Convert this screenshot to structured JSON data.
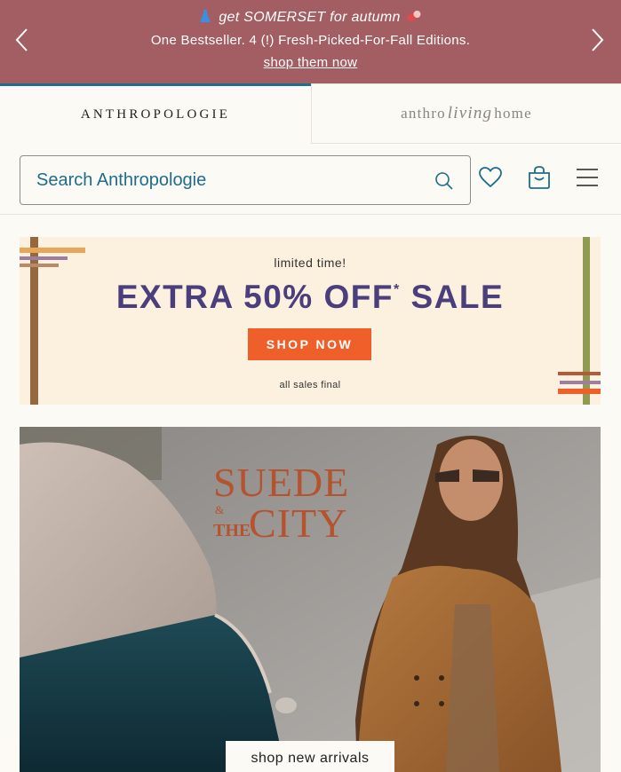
{
  "promo": {
    "line1": "get SOMERSET for autumn",
    "line2": "One Bestseller. 4 (!) Fresh-Picked-For-Fall Editions.",
    "link": "shop them now",
    "prev_icon": "chevron-left-icon",
    "next_icon": "chevron-right-icon",
    "background": "#a35e63"
  },
  "brands": {
    "primary": "ANTHROPOLOGIE",
    "secondary_left": "anthro",
    "secondary_script": "living",
    "secondary_right": "home",
    "active_accent": "#1e6e8e"
  },
  "header": {
    "search_placeholder": "Search Anthropologie",
    "icons": [
      "search-icon",
      "heart-icon",
      "shopping-bag-icon",
      "hamburger-menu-icon"
    ]
  },
  "sale_banner": {
    "kicker": "limited time!",
    "headline": "EXTRA 50% OFF",
    "asterisk": "*",
    "headline_end": "SALE",
    "button": "SHOP NOW",
    "footnote": "all sales final",
    "headline_color": "#4a3e7c",
    "button_color": "#ef5f2a",
    "background": "#fcf0df"
  },
  "hero": {
    "title_line1": "SUEDE",
    "title_amp": "&",
    "title_the": "THE",
    "title_line2": "CITY",
    "button": "shop new arrivals",
    "title_color": "#b5532e"
  }
}
